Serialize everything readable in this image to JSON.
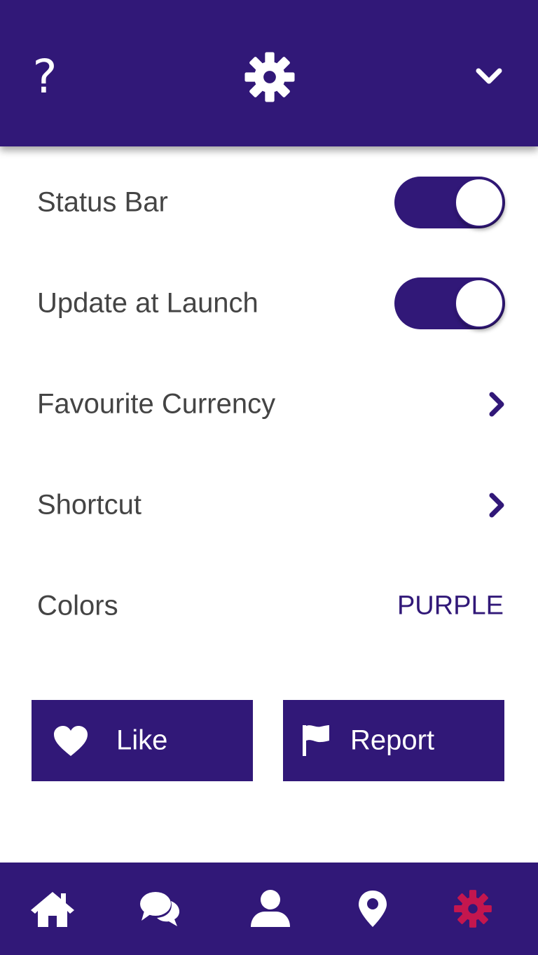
{
  "header": {
    "help_glyph": "?",
    "center_icon": "gear-icon",
    "menu_icon": "chevron-down-icon"
  },
  "settings": {
    "status_bar": {
      "label": "Status Bar",
      "enabled": true
    },
    "update_at_launch": {
      "label": "Update at Launch",
      "enabled": true
    },
    "favourite_currency": {
      "label": "Favourite Currency"
    },
    "shortcut": {
      "label": "Shortcut"
    },
    "colors": {
      "label": "Colors",
      "value": "PURPLE"
    }
  },
  "actions": {
    "like": {
      "label": "Like",
      "icon": "heart-icon"
    },
    "report": {
      "label": "Report",
      "icon": "flag-icon"
    }
  },
  "tabbar": {
    "items": [
      {
        "icon": "home-icon",
        "active": false
      },
      {
        "icon": "chat-icon",
        "active": false
      },
      {
        "icon": "user-icon",
        "active": false
      },
      {
        "icon": "location-pin-icon",
        "active": false
      },
      {
        "icon": "gear-icon",
        "active": true
      }
    ]
  },
  "colors": {
    "primary": "#311878",
    "active_tab": "#C4164E",
    "label_text": "#444444",
    "background": "#FFFFFF"
  }
}
